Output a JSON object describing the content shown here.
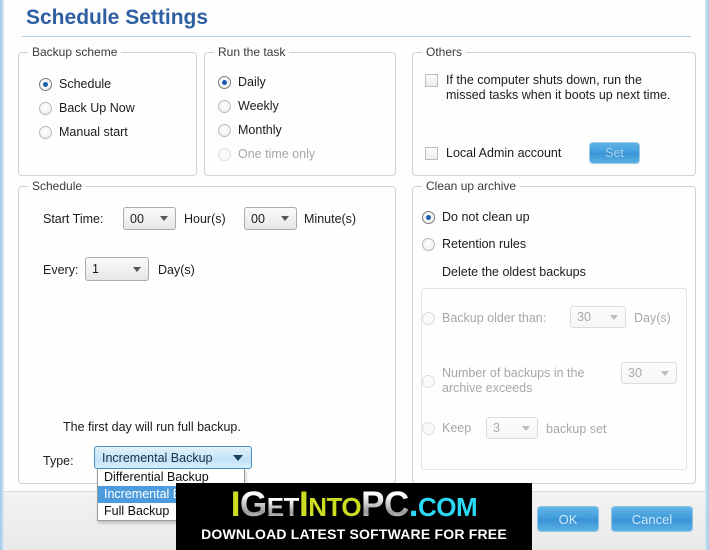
{
  "window": {
    "title": "Schedule Settings"
  },
  "backup_scheme": {
    "title": "Backup scheme",
    "options": [
      {
        "label": "Schedule",
        "checked": true
      },
      {
        "label": "Back Up Now",
        "checked": false
      },
      {
        "label": "Manual start",
        "checked": false
      }
    ]
  },
  "run_the_task": {
    "title": "Run the task",
    "options": [
      {
        "label": "Daily",
        "checked": true
      },
      {
        "label": "Weekly",
        "checked": false
      },
      {
        "label": "Monthly",
        "checked": false
      },
      {
        "label": "One time only",
        "checked": false
      }
    ]
  },
  "others": {
    "title": "Others",
    "shutdown_checkbox": {
      "label": "If the computer shuts down, run the missed tasks when it boots up next time.",
      "checked": false
    },
    "local_admin_checkbox": {
      "label": "Local Admin account",
      "checked": false
    },
    "set_button": "Set"
  },
  "schedule": {
    "title": "Schedule",
    "start_time_label": "Start Time:",
    "hour_value": "00",
    "hour_unit": "Hour(s)",
    "minute_value": "00",
    "minute_unit": "Minute(s)",
    "every_label": "Every:",
    "every_value": "1",
    "every_unit": "Day(s)",
    "note": "The first day will run full backup.",
    "type_label": "Type:",
    "type_value": "Incremental Backup",
    "type_options": [
      {
        "label": "Differential Backup",
        "selected": false
      },
      {
        "label": "Incremental Backup",
        "selected": true
      },
      {
        "label": "Full Backup",
        "selected": false
      }
    ]
  },
  "clean_up_archive": {
    "title": "Clean up archive",
    "do_not_clean_up": {
      "label": "Do not clean up",
      "checked": true
    },
    "retention_rules": {
      "label": "Retention rules",
      "checked": false
    },
    "delete_oldest_label": "Delete the oldest backups",
    "backup_older_than": {
      "label": "Backup older than:",
      "value": "30",
      "unit": "Day(s)",
      "checked": false
    },
    "number_of_backups": {
      "label": "Number of backups in the archive exceeds",
      "value": "30",
      "checked": false
    },
    "keep": {
      "label": "Keep",
      "value": "3",
      "unit": "backup set",
      "checked": false
    }
  },
  "footer": {
    "ok_label": "OK",
    "cancel_label": "Cancel"
  },
  "watermark": {
    "part1": "I",
    "part2": "G",
    "part3": "ET",
    "part4": "I",
    "part5": "NTO",
    "part6": "PC",
    "part7": ".",
    "part8": "COM",
    "subtitle_words": "DOWNLOAD LATEST SOFTWARE FOR FREE"
  },
  "colors": {
    "title_blue": "#2e5fa3",
    "accent_blue": "#3f9bda",
    "selected_row": "#4b9bdd"
  }
}
